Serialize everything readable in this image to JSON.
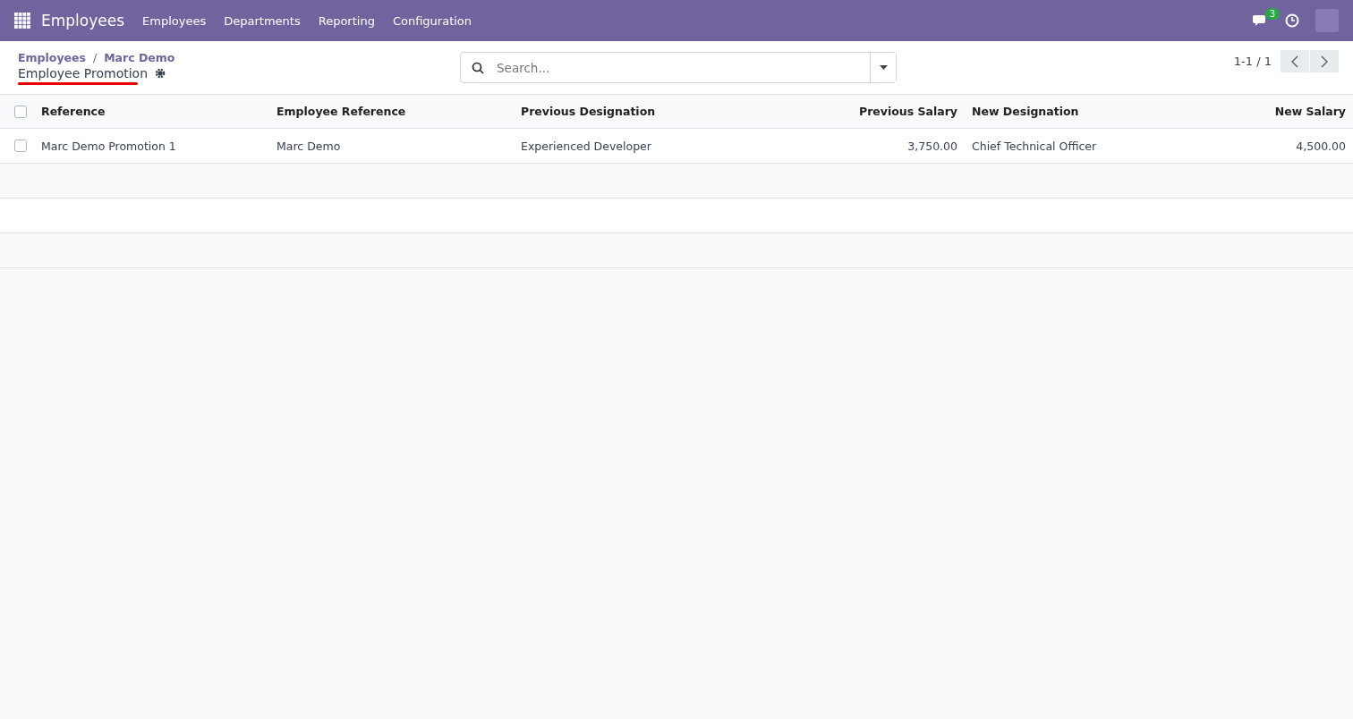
{
  "navbar": {
    "app_title": "Employees",
    "menu": [
      "Employees",
      "Departments",
      "Reporting",
      "Configuration"
    ],
    "messages_badge": "3"
  },
  "breadcrumb": {
    "items": [
      "Employees",
      "Marc Demo"
    ],
    "separator": "/",
    "current": "Employee Promotion"
  },
  "search": {
    "placeholder": "Search..."
  },
  "pager": {
    "text": "1-1 / 1"
  },
  "table": {
    "columns": [
      {
        "label": "Reference",
        "kind": "text"
      },
      {
        "label": "Employee Reference",
        "kind": "text"
      },
      {
        "label": "Previous Designation",
        "kind": "text"
      },
      {
        "label": "Previous Salary",
        "kind": "numeric"
      },
      {
        "label": "New Designation",
        "kind": "text"
      },
      {
        "label": "New Salary",
        "kind": "numeric"
      }
    ],
    "header_checked": false,
    "rows": [
      {
        "checked": false,
        "cells": [
          "Marc Demo Promotion 1",
          "Marc Demo",
          "Experienced Developer",
          "3,750.00",
          "Chief Technical Officer",
          "4,500.00"
        ]
      }
    ]
  }
}
